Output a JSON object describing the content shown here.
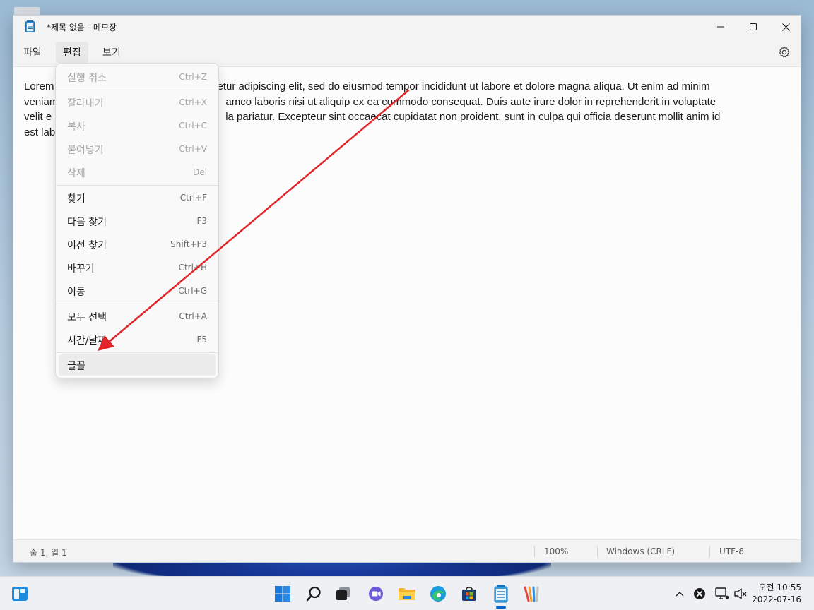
{
  "window": {
    "title": "*제목 없음 - 메모장",
    "controls": {
      "minimize": "minimize",
      "maximize": "maximize",
      "close": "close"
    }
  },
  "menubar": {
    "items": [
      {
        "label": "파일"
      },
      {
        "label": "편집"
      },
      {
        "label": "보기"
      }
    ],
    "active": "편집"
  },
  "editor": {
    "visible_lines": [
      "Lorem",
      "etur adipiscing elit, sed do eiusmod tempor incididunt ut labore et dolore magna aliqua. Ut enim ad minim",
      "veniam",
      "amco laboris nisi ut aliquip ex ea commodo consequat. Duis aute irure dolor in reprehenderit in voluptate",
      "velit e",
      "la pariatur. Excepteur sint occaecat cupidatat non proident, sunt in culpa qui officia deserunt mollit anim id",
      "est lab"
    ]
  },
  "edit_menu": {
    "groups": [
      [
        {
          "label": "실행 취소",
          "shortcut": "Ctrl+Z",
          "enabled": false
        }
      ],
      [
        {
          "label": "잘라내기",
          "shortcut": "Ctrl+X",
          "enabled": false
        },
        {
          "label": "복사",
          "shortcut": "Ctrl+C",
          "enabled": false
        },
        {
          "label": "붙여넣기",
          "shortcut": "Ctrl+V",
          "enabled": false
        },
        {
          "label": "삭제",
          "shortcut": "Del",
          "enabled": false
        }
      ],
      [
        {
          "label": "찾기",
          "shortcut": "Ctrl+F",
          "enabled": true
        },
        {
          "label": "다음 찾기",
          "shortcut": "F3",
          "enabled": true
        },
        {
          "label": "이전 찾기",
          "shortcut": "Shift+F3",
          "enabled": true
        },
        {
          "label": "바꾸기",
          "shortcut": "Ctrl+H",
          "enabled": true
        },
        {
          "label": "이동",
          "shortcut": "Ctrl+G",
          "enabled": true
        }
      ],
      [
        {
          "label": "모두 선택",
          "shortcut": "Ctrl+A",
          "enabled": true
        },
        {
          "label": "시간/날짜",
          "shortcut": "F5",
          "enabled": true
        }
      ],
      [
        {
          "label": "글꼴",
          "shortcut": "",
          "enabled": true,
          "hovered": true
        }
      ]
    ]
  },
  "statusbar": {
    "position": "줄 1, 열 1",
    "zoom": "100%",
    "line_ending": "Windows (CRLF)",
    "encoding": "UTF-8"
  },
  "taskbar": {
    "icons": [
      "widgets-icon",
      "start-icon",
      "search-icon",
      "task-view-icon",
      "chat-icon",
      "file-explorer-icon",
      "edge-icon",
      "store-icon",
      "notepad-icon",
      "paint-app-icon"
    ],
    "clock": {
      "period_time": "오전 10:55",
      "date": "2022-07-16"
    }
  },
  "colors": {
    "annotation_arrow": "#e0262b",
    "accent": "#0a64c8"
  }
}
